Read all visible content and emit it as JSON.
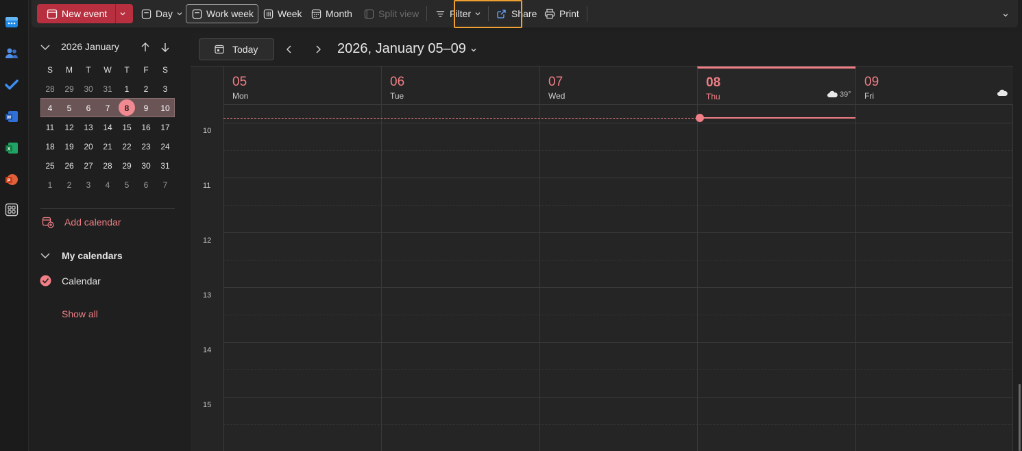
{
  "toolbar": {
    "new_event": "New event",
    "day": "Day",
    "work_week": "Work week",
    "week": "Week",
    "month": "Month",
    "split_view": "Split view",
    "filter": "Filter",
    "share": "Share",
    "print": "Print"
  },
  "mini_calendar": {
    "title": "2026 January",
    "dow": [
      "S",
      "M",
      "T",
      "W",
      "T",
      "F",
      "S"
    ],
    "weeks": [
      [
        "28",
        "29",
        "30",
        "31",
        "1",
        "2",
        "3"
      ],
      [
        "4",
        "5",
        "6",
        "7",
        "8",
        "9",
        "10"
      ],
      [
        "11",
        "12",
        "13",
        "14",
        "15",
        "16",
        "17"
      ],
      [
        "18",
        "19",
        "20",
        "21",
        "22",
        "23",
        "24"
      ],
      [
        "25",
        "26",
        "27",
        "28",
        "29",
        "30",
        "31"
      ],
      [
        "1",
        "2",
        "3",
        "4",
        "5",
        "6",
        "7"
      ]
    ],
    "today": "8"
  },
  "left_pane": {
    "add_calendar": "Add calendar",
    "my_calendars": "My calendars",
    "calendar": "Calendar",
    "show_all": "Show all"
  },
  "nav": {
    "today": "Today",
    "range": "2026, January 05–09"
  },
  "days": [
    {
      "num": "05",
      "name": "Mon"
    },
    {
      "num": "06",
      "name": "Tue"
    },
    {
      "num": "07",
      "name": "Wed"
    },
    {
      "num": "08",
      "name": "Thu",
      "weather": "39°"
    },
    {
      "num": "09",
      "name": "Fri"
    }
  ],
  "hours": [
    "10",
    "11",
    "12",
    "13",
    "14",
    "15"
  ],
  "colors": {
    "accent": "#f07f86",
    "new_event_bg": "#b8303f",
    "share_highlight": "#f0a030"
  }
}
